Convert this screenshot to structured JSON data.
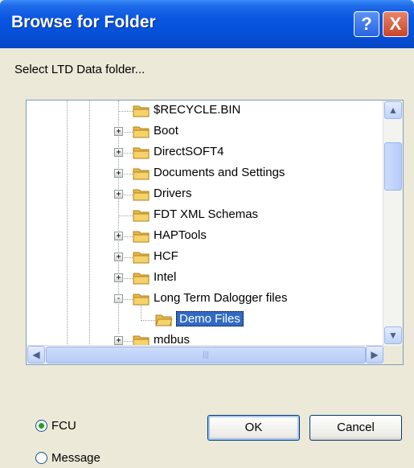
{
  "window": {
    "title": "Browse for Folder"
  },
  "titlebar_buttons": {
    "help": "?",
    "close": "X"
  },
  "prompt": "Select LTD Data folder...",
  "tree": {
    "items": [
      {
        "label": "$RECYCLE.BIN",
        "expander": "",
        "selected": false
      },
      {
        "label": "Boot",
        "expander": "+",
        "selected": false
      },
      {
        "label": "DirectSOFT4",
        "expander": "+",
        "selected": false
      },
      {
        "label": "Documents and Settings",
        "expander": "+",
        "selected": false
      },
      {
        "label": "Drivers",
        "expander": "+",
        "selected": false
      },
      {
        "label": "FDT XML Schemas",
        "expander": "",
        "selected": false
      },
      {
        "label": "HAPTools",
        "expander": "+",
        "selected": false
      },
      {
        "label": "HCF",
        "expander": "+",
        "selected": false
      },
      {
        "label": "Intel",
        "expander": "+",
        "selected": false
      },
      {
        "label": "Long Term Dalogger files",
        "expander": "-",
        "selected": false
      },
      {
        "label": "Demo Files",
        "expander": "",
        "selected": true
      },
      {
        "label": "mdbus",
        "expander": "+",
        "selected": false
      }
    ]
  },
  "radios": [
    {
      "label": "FCU",
      "checked": true
    },
    {
      "label": "Message",
      "checked": false
    }
  ],
  "buttons": {
    "ok": "OK",
    "cancel": "Cancel"
  },
  "colors": {
    "titlebar": "#0a55e0",
    "selection": "#316ac5",
    "folder": "#f5d36a"
  },
  "icons": {
    "folder": "folder-icon",
    "open_folder": "open-folder-icon"
  }
}
